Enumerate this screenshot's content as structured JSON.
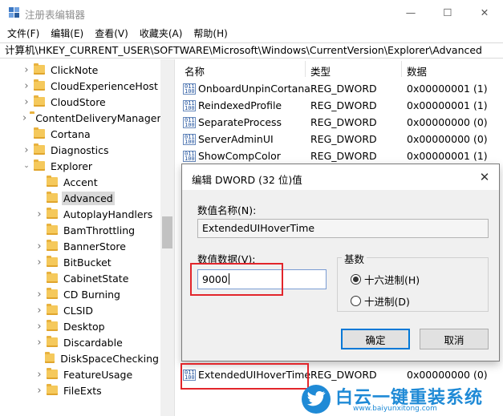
{
  "window": {
    "title": "注册表编辑器",
    "minimize_glyph": "—",
    "maximize_glyph": "☐",
    "close_glyph": "✕"
  },
  "menu": [
    "文件(F)",
    "编辑(E)",
    "查看(V)",
    "收藏夹(A)",
    "帮助(H)"
  ],
  "address": "计算机\\HKEY_CURRENT_USER\\SOFTWARE\\Microsoft\\Windows\\CurrentVersion\\Explorer\\Advanced",
  "tree": {
    "items": [
      {
        "label": "ClickNote",
        "level": 0,
        "expanded": false
      },
      {
        "label": "CloudExperienceHost",
        "level": 0,
        "expanded": false
      },
      {
        "label": "CloudStore",
        "level": 0,
        "expanded": false
      },
      {
        "label": "ContentDeliveryManager",
        "level": 0,
        "expanded": false
      },
      {
        "label": "Cortana",
        "level": 0,
        "expanded": null
      },
      {
        "label": "Diagnostics",
        "level": 0,
        "expanded": false
      },
      {
        "label": "Explorer",
        "level": 0,
        "expanded": true
      },
      {
        "label": "Accent",
        "level": 1,
        "expanded": null
      },
      {
        "label": "Advanced",
        "level": 1,
        "expanded": null,
        "selected": true
      },
      {
        "label": "AutoplayHandlers",
        "level": 1,
        "expanded": false
      },
      {
        "label": "BamThrottling",
        "level": 1,
        "expanded": null
      },
      {
        "label": "BannerStore",
        "level": 1,
        "expanded": false
      },
      {
        "label": "BitBucket",
        "level": 1,
        "expanded": false
      },
      {
        "label": "CabinetState",
        "level": 1,
        "expanded": null
      },
      {
        "label": "CD Burning",
        "level": 1,
        "expanded": false
      },
      {
        "label": "CLSID",
        "level": 1,
        "expanded": false
      },
      {
        "label": "Desktop",
        "level": 1,
        "expanded": false
      },
      {
        "label": "Discardable",
        "level": 1,
        "expanded": false
      },
      {
        "label": "DiskSpaceChecking",
        "level": 1,
        "expanded": null
      },
      {
        "label": "FeatureUsage",
        "level": 1,
        "expanded": false
      },
      {
        "label": "FileExts",
        "level": 1,
        "expanded": false
      }
    ]
  },
  "list": {
    "headers": {
      "name": "名称",
      "type": "类型",
      "data": "数据"
    },
    "rows": [
      {
        "name": "OnboardUnpinCortana",
        "type": "REG_DWORD",
        "data": "0x00000001 (1)"
      },
      {
        "name": "ReindexedProfile",
        "type": "REG_DWORD",
        "data": "0x00000001 (1)"
      },
      {
        "name": "SeparateProcess",
        "type": "REG_DWORD",
        "data": "0x00000000 (0)"
      },
      {
        "name": "ServerAdminUI",
        "type": "REG_DWORD",
        "data": "0x00000000 (0)"
      },
      {
        "name": "ShowCompColor",
        "type": "REG_DWORD",
        "data": "0x00000001 (1)"
      }
    ],
    "bottom_row": {
      "name": "ExtendedUIHoverTime",
      "type": "REG_DWORD",
      "data": "0x00000000 (0)"
    }
  },
  "dialog": {
    "title": "编辑 DWORD (32 位)值",
    "name_label": "数值名称(N):",
    "name_value": "ExtendedUIHoverTime",
    "data_label": "数值数据(V):",
    "data_value": "9000",
    "base_label": "基数",
    "base_hex": "十六进制(H)",
    "base_dec": "十进制(D)",
    "selected_base": "hex",
    "ok": "确定",
    "cancel": "取消"
  },
  "watermark": {
    "text": "白云一键重装系统",
    "url": "www.baiyunxitong.com"
  }
}
